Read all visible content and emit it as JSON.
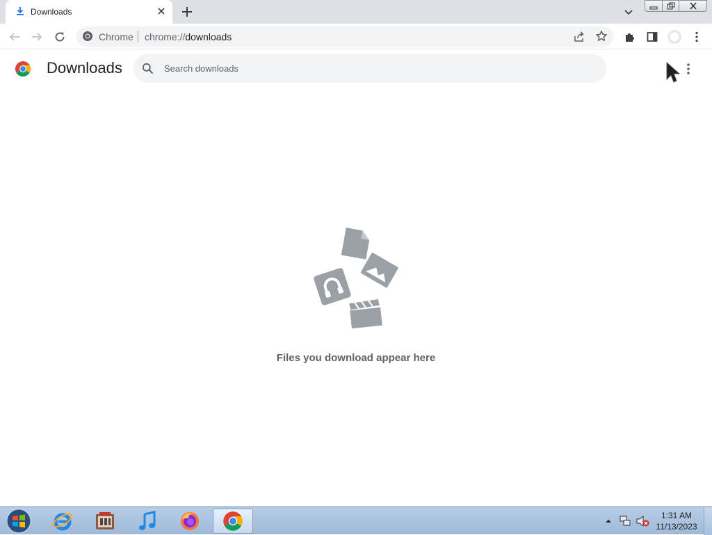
{
  "browser": {
    "tab": {
      "title": "Downloads",
      "icon": "download-icon"
    },
    "omnibox": {
      "site_name": "Chrome",
      "url_scheme": "chrome://",
      "url_path": "downloads"
    }
  },
  "page": {
    "title": "Downloads",
    "search": {
      "placeholder": "Search downloads",
      "value": ""
    },
    "empty_message": "Files you download appear here"
  },
  "taskbar": {
    "apps": [
      {
        "name": "Internet Explorer",
        "icon": "internet-explorer-icon"
      },
      {
        "name": "Media Player",
        "icon": "media-player-icon"
      },
      {
        "name": "iTunes",
        "icon": "music-note-icon"
      },
      {
        "name": "Firefox",
        "icon": "firefox-icon"
      },
      {
        "name": "Google Chrome",
        "icon": "chrome-icon",
        "active": true
      }
    ],
    "clock": {
      "time": "1:31 AM",
      "date": "11/13/2023"
    }
  },
  "colors": {
    "chrome_red": "#db4437",
    "chrome_green": "#0f9d58",
    "chrome_yellow": "#f4b400",
    "chrome_blue": "#4285f4",
    "illustration_gray": "#9aa0a6"
  }
}
